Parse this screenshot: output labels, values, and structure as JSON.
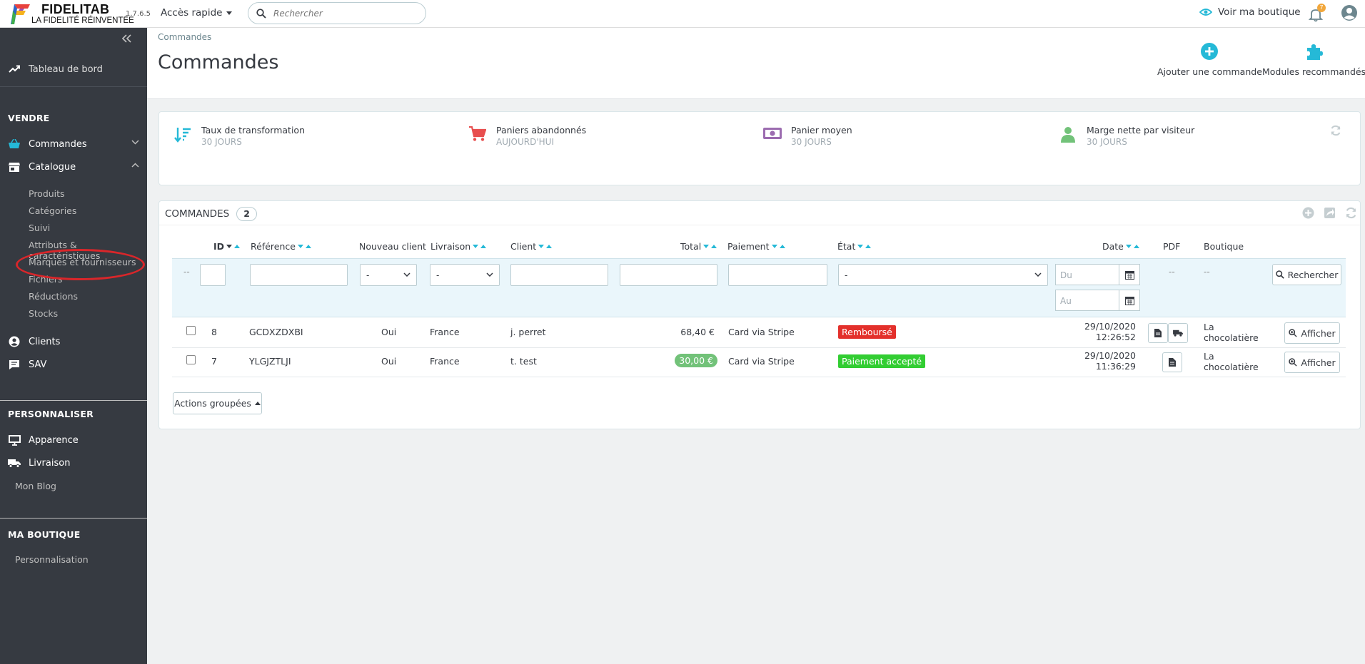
{
  "header": {
    "logo_name": "FIDELITAB",
    "logo_tagline": "LA FIDELITÉ RÉINVENTÉE",
    "version": "1.7.6.5",
    "quick_access": "Accès rapide",
    "search_placeholder": "Rechercher",
    "view_shop": "Voir ma boutique",
    "notifications_count": "7"
  },
  "sidebar": {
    "dashboard": "Tableau de bord",
    "section_sell": "VENDRE",
    "orders": "Commandes",
    "catalog": "Catalogue",
    "catalog_items": [
      "Produits",
      "Catégories",
      "Suivi",
      "Attributs & caractéristiques",
      "Marques et fournisseurs",
      "Fichiers",
      "Réductions",
      "Stocks"
    ],
    "customers": "Clients",
    "sav": "SAV",
    "section_customize": "PERSONNALISER",
    "appearance": "Apparence",
    "shipping": "Livraison",
    "blog": "Mon Blog",
    "section_shop": "MA BOUTIQUE",
    "personalization": "Personnalisation"
  },
  "page": {
    "breadcrumb": "Commandes",
    "title": "Commandes",
    "toolbar": {
      "add_order": "Ajouter une commande",
      "recommended_modules": "Modules recommandés"
    }
  },
  "kpis": [
    {
      "title": "Taux de transformation",
      "subtitle": "30 JOURS",
      "icon": "sort-amount-icon",
      "color": "#25b9d7"
    },
    {
      "title": "Paniers abandonnés",
      "subtitle": "AUJOURD'HUI",
      "icon": "cart-icon",
      "color": "#e84e4e"
    },
    {
      "title": "Panier moyen",
      "subtitle": "30 JOURS",
      "icon": "money-icon",
      "color": "#9c6cb0"
    },
    {
      "title": "Marge nette par visiteur",
      "subtitle": "30 JOURS",
      "icon": "user-icon",
      "color": "#72c279"
    }
  ],
  "orders_panel": {
    "title": "COMMANDES",
    "count": "2",
    "columns": [
      "ID",
      "Référence",
      "Nouveau client",
      "Livraison",
      "Client",
      "Total",
      "Paiement",
      "État",
      "Date",
      "PDF",
      "Boutique"
    ],
    "filters": {
      "dash": "--",
      "select_default": "-",
      "date_from": "Du",
      "date_to": "Au",
      "search_button": "Rechercher"
    },
    "rows": [
      {
        "id": "8",
        "reference": "GCDXZDXBI",
        "new_client": "Oui",
        "delivery": "France",
        "client": "j. perret",
        "total": "68,40 €",
        "payment": "Card via Stripe",
        "status": "Remboursé",
        "status_color": "#e3302b",
        "date": "29/10/2020",
        "time": "12:26:52",
        "shop_line1": "La",
        "shop_line2": "chocolatière",
        "action": "Afficher"
      },
      {
        "id": "7",
        "reference": "YLGJZTLJI",
        "new_client": "Oui",
        "delivery": "France",
        "client": "t. test",
        "total": "30,00 €",
        "payment": "Card via Stripe",
        "status": "Paiement accepté",
        "status_color": "#32cd32",
        "date": "29/10/2020",
        "time": "11:36:29",
        "shop_line1": "La",
        "shop_line2": "chocolatière",
        "action": "Afficher"
      }
    ],
    "bulk_actions": "Actions groupées"
  }
}
